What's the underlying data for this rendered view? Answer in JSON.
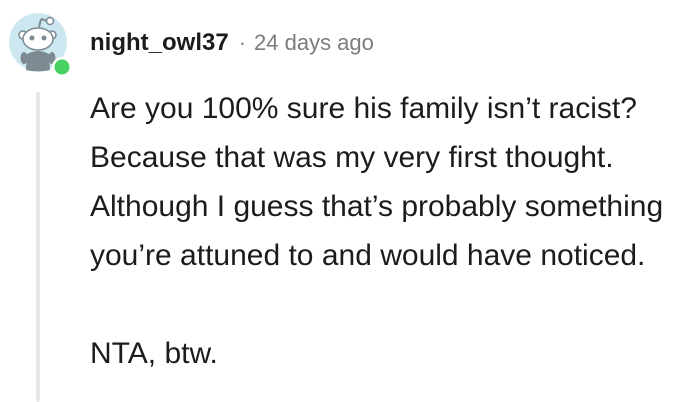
{
  "comment": {
    "author": "night_owl37",
    "separator": "·",
    "timestamp": "24 days ago",
    "body": {
      "paragraph_1": "Are you 100% sure his family isn’t racist? Because that was my very first thought. Although I guess that’s probably something you’re attuned to and would have noticed.",
      "paragraph_2": "NTA, btw."
    },
    "avatar": {
      "icon": "snoo-avatar-icon",
      "background_color": "#cde7f1",
      "online_dot_color": "#46d160"
    }
  },
  "colors": {
    "text": "#1c1c1c",
    "meta": "#7c7c7c",
    "thread_line": "#e6e9ec"
  }
}
